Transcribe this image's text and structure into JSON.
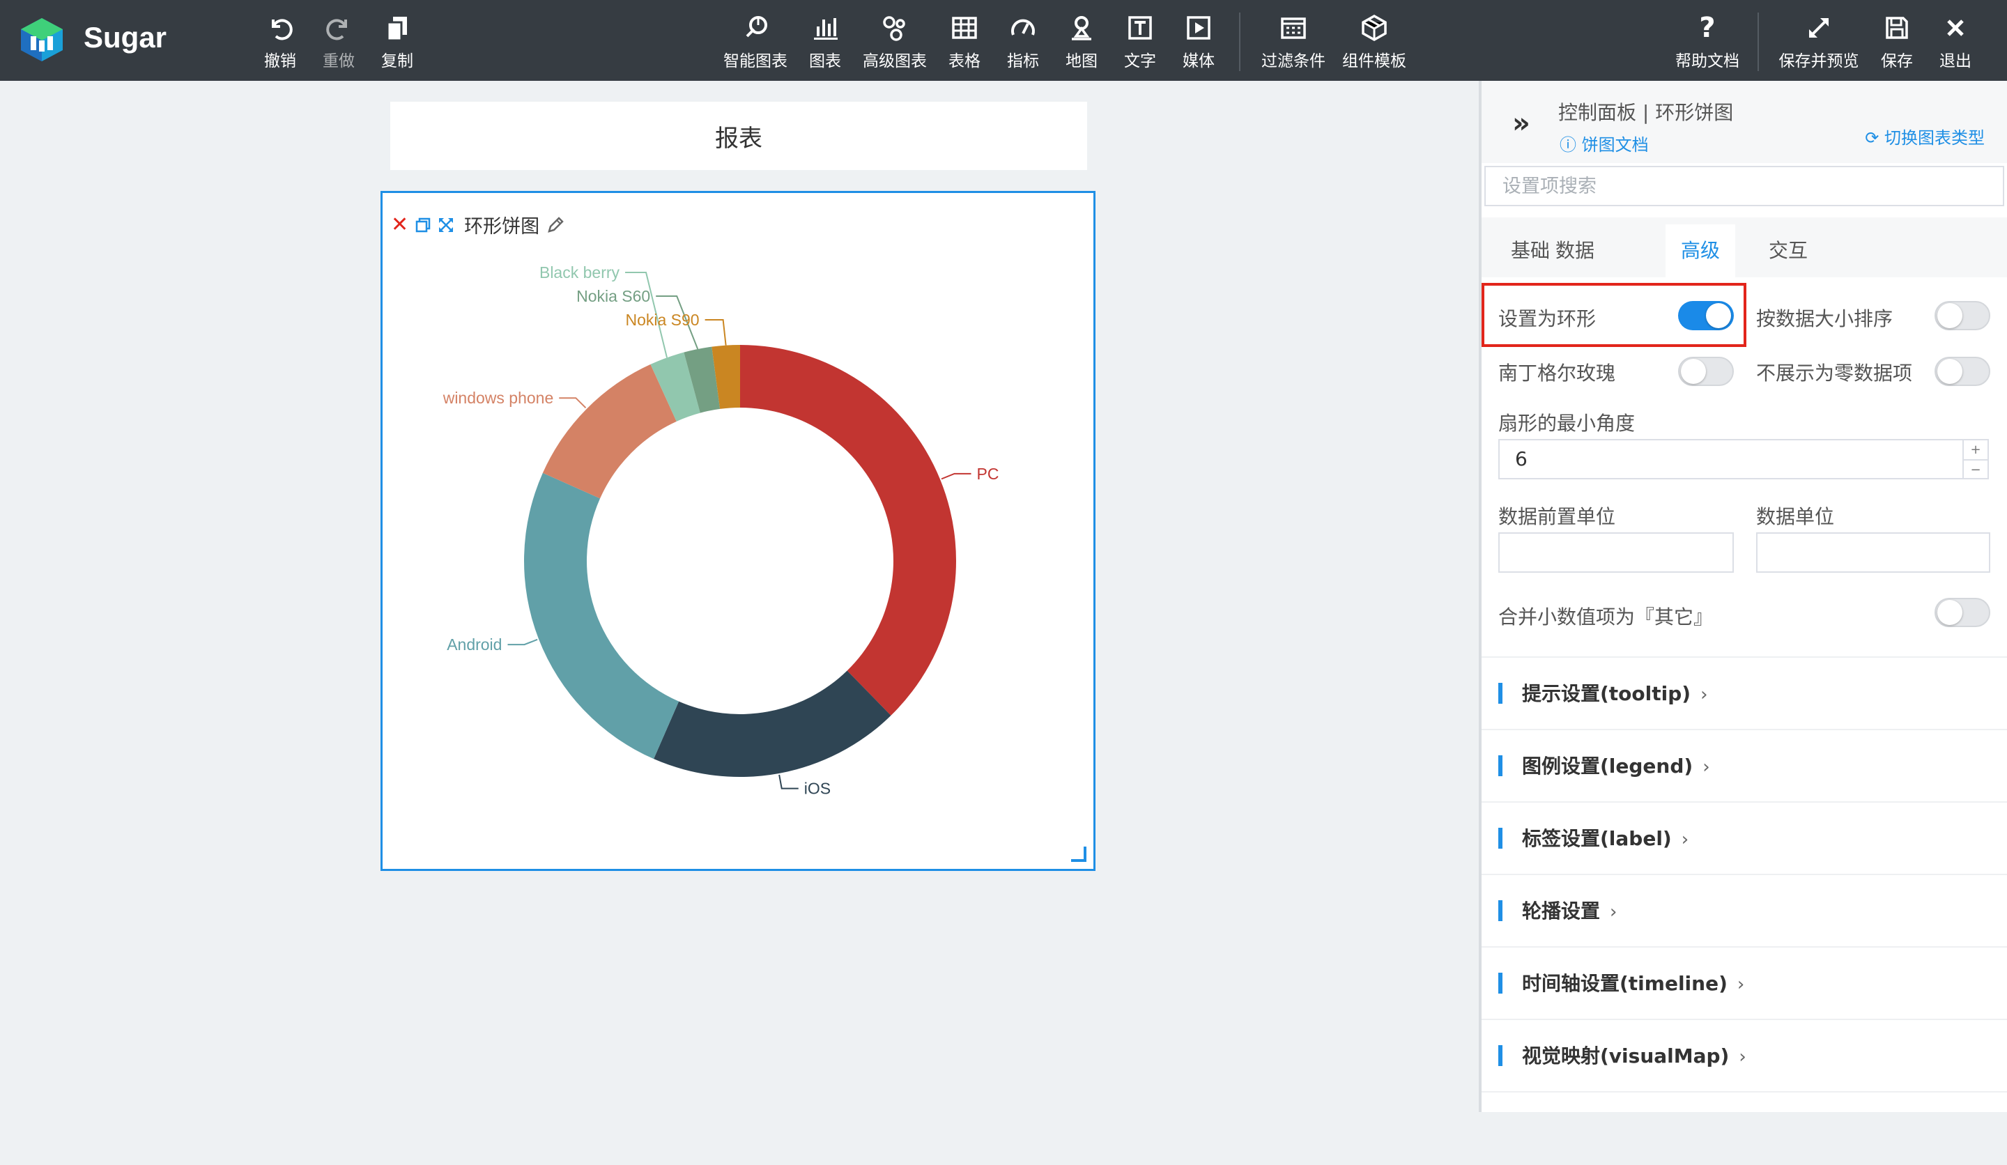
{
  "app": {
    "name": "Sugar"
  },
  "toolbar": {
    "left": [
      {
        "label": "撤销",
        "icon": "undo-icon"
      },
      {
        "label": "重做",
        "icon": "redo-icon"
      },
      {
        "label": "复制",
        "icon": "copy-icon"
      }
    ],
    "center": [
      {
        "label": "智能图表",
        "icon": "smart-chart-icon"
      },
      {
        "label": "图表",
        "icon": "bar-chart-icon"
      },
      {
        "label": "高级图表",
        "icon": "advanced-chart-icon"
      },
      {
        "label": "表格",
        "icon": "table-icon"
      },
      {
        "label": "指标",
        "icon": "gauge-icon"
      },
      {
        "label": "地图",
        "icon": "map-pin-icon"
      },
      {
        "label": "文字",
        "icon": "text-icon"
      },
      {
        "label": "媒体",
        "icon": "media-icon"
      },
      {
        "label": "过滤条件",
        "icon": "filter-icon"
      },
      {
        "label": "组件模板",
        "icon": "template-icon"
      }
    ],
    "right": [
      {
        "label": "帮助文档",
        "icon": "help-icon"
      },
      {
        "label": "保存并预览",
        "icon": "expand-icon"
      },
      {
        "label": "保存",
        "icon": "save-icon"
      },
      {
        "label": "退出",
        "icon": "close-icon"
      }
    ]
  },
  "canvas": {
    "report_title": "报表",
    "chart_card_title": "环形饼图"
  },
  "chart_data": {
    "type": "pie",
    "donut": true,
    "slices": [
      {
        "name": "PC",
        "value": 36,
        "color": "#c23531"
      },
      {
        "name": "iOS",
        "value": 18,
        "color": "#2f4554"
      },
      {
        "name": "Android",
        "value": 24,
        "color": "#61a0a8"
      },
      {
        "name": "windows phone",
        "value": 11,
        "color": "#d48265"
      },
      {
        "name": "Black berry",
        "value": 2.5,
        "color": "#91c7ae"
      },
      {
        "name": "Nokia S60",
        "value": 2,
        "color": "#749f83"
      },
      {
        "name": "Nokia S90",
        "value": 2,
        "color": "#ca8622"
      }
    ],
    "labels_outside": true
  },
  "panel": {
    "title": "控制面板 | 环形饼图",
    "doc_link": "饼图文档",
    "switch_type": "切换图表类型",
    "search_placeholder": "设置项搜索",
    "tabs": [
      "基础",
      "数据",
      "高级",
      "交互"
    ],
    "active_tab": "高级",
    "settings": {
      "ring_label": "设置为环形",
      "ring_on": true,
      "sort_label": "按数据大小排序",
      "sort_on": false,
      "rose_label": "南丁格尔玫瑰",
      "rose_on": false,
      "hide_zero_label": "不展示为零数据项",
      "hide_zero_on": false,
      "min_angle_label": "扇形的最小角度",
      "min_angle_value": "6",
      "prefix_unit_label": "数据前置单位",
      "unit_label": "数据单位",
      "merge_small_label": "合并小数值项为『其它』",
      "merge_small_on": false
    },
    "sections": [
      "提示设置(tooltip)",
      "图例设置(legend)",
      "标签设置(label)",
      "轮播设置",
      "时间轴设置(timeline)",
      "视觉映射(visualMap)"
    ]
  }
}
